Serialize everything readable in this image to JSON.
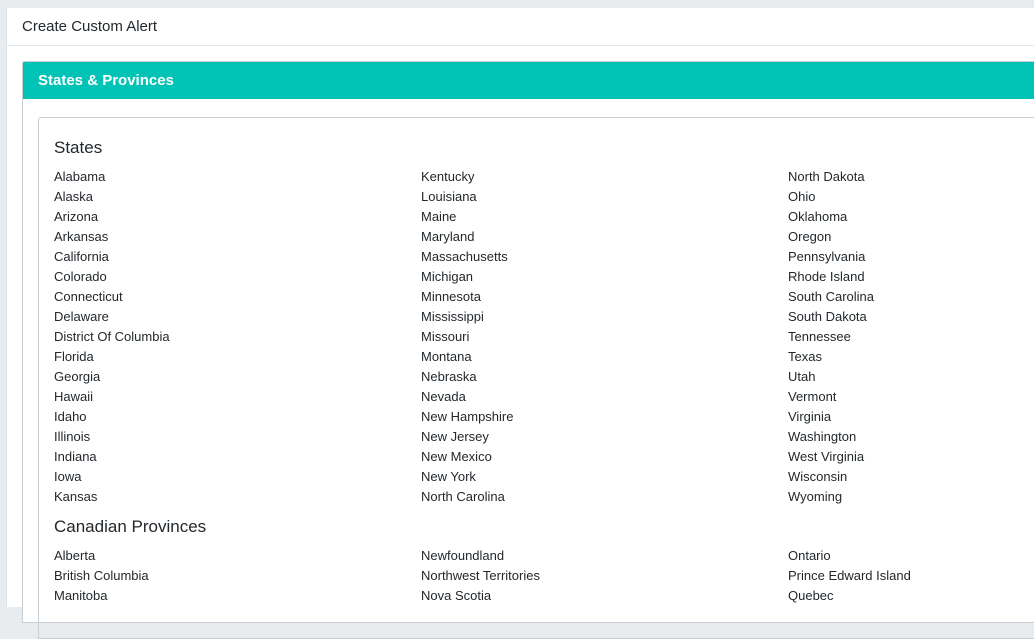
{
  "page": {
    "title": "Create Custom Alert"
  },
  "card": {
    "title": "States & Provinces"
  },
  "states": {
    "title": "States",
    "items": [
      "Alabama",
      "Alaska",
      "Arizona",
      "Arkansas",
      "California",
      "Colorado",
      "Connecticut",
      "Delaware",
      "District Of Columbia",
      "Florida",
      "Georgia",
      "Hawaii",
      "Idaho",
      "Illinois",
      "Indiana",
      "Iowa",
      "Kansas",
      "Kentucky",
      "Louisiana",
      "Maine",
      "Maryland",
      "Massachusetts",
      "Michigan",
      "Minnesota",
      "Mississippi",
      "Missouri",
      "Montana",
      "Nebraska",
      "Nevada",
      "New Hampshire",
      "New Jersey",
      "New Mexico",
      "New York",
      "North Carolina",
      "North Dakota",
      "Ohio",
      "Oklahoma",
      "Oregon",
      "Pennsylvania",
      "Rhode Island",
      "South Carolina",
      "South Dakota",
      "Tennessee",
      "Texas",
      "Utah",
      "Vermont",
      "Virginia",
      "Washington",
      "West Virginia",
      "Wisconsin",
      "Wyoming"
    ]
  },
  "provinces": {
    "title": "Canadian Provinces",
    "items": [
      "Alberta",
      "British Columbia",
      "Manitoba",
      "Newfoundland",
      "Northwest Territories",
      "Nova Scotia",
      "Ontario",
      "Prince Edward Island",
      "Quebec"
    ]
  }
}
